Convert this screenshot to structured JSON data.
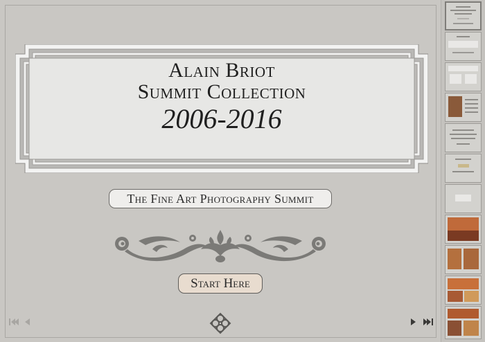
{
  "title": {
    "line1": "Alain Briot",
    "line2": "Summit Collection",
    "years": "2006-2016"
  },
  "subtitle": "The Fine Art Photography Summit",
  "start_button": "Start Here",
  "colors": {
    "page_background": "#c9c7c3",
    "ornament": "#7b7a77",
    "start_button_fill": "#e8dccf",
    "panel_fill": "#e7e7e5"
  },
  "navigation": {
    "first_icon": "skip-to-first-icon",
    "prev_icon": "previous-page-icon",
    "next_icon": "next-page-icon",
    "last_icon": "skip-to-last-icon",
    "home_icon": "celtic-knot-emblem-icon"
  },
  "thumbnails": {
    "count": 11,
    "selected_index": 0
  }
}
